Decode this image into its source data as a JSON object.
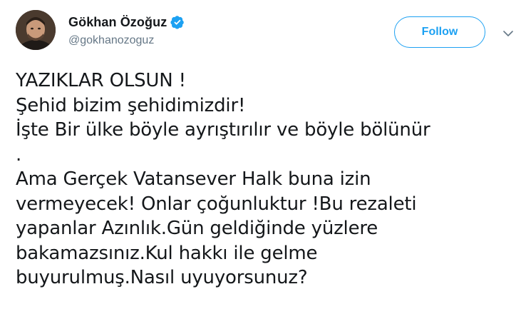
{
  "user": {
    "display_name": "Gökhan Özoğuz",
    "handle": "@gokhanozoguz",
    "avatar_icon": "profile-photo",
    "verified_icon": "verified-badge-icon"
  },
  "actions": {
    "follow_label": "Follow",
    "caret_icon": "chevron-down-icon"
  },
  "tweet": {
    "lines": [
      "YAZIKLAR OLSUN !",
      "Şehid bizim şehidimizdir!",
      "İşte Bir ülke böyle ayrıştırılır ve böyle bölünür",
      ".",
      "Ama Gerçek Vatansever Halk buna izin",
      "vermeyecek! Onlar çoğunluktur !Bu rezaleti",
      "yapanlar Azınlık.Gün geldiğinde yüzlere",
      "bakamazsınız.Kul hakkı ile gelme",
      "buyurulmuş.Nasıl uyuyorsunuz?"
    ]
  },
  "colors": {
    "accent": "#1da1f2",
    "text": "#14171a",
    "secondary": "#657786"
  }
}
